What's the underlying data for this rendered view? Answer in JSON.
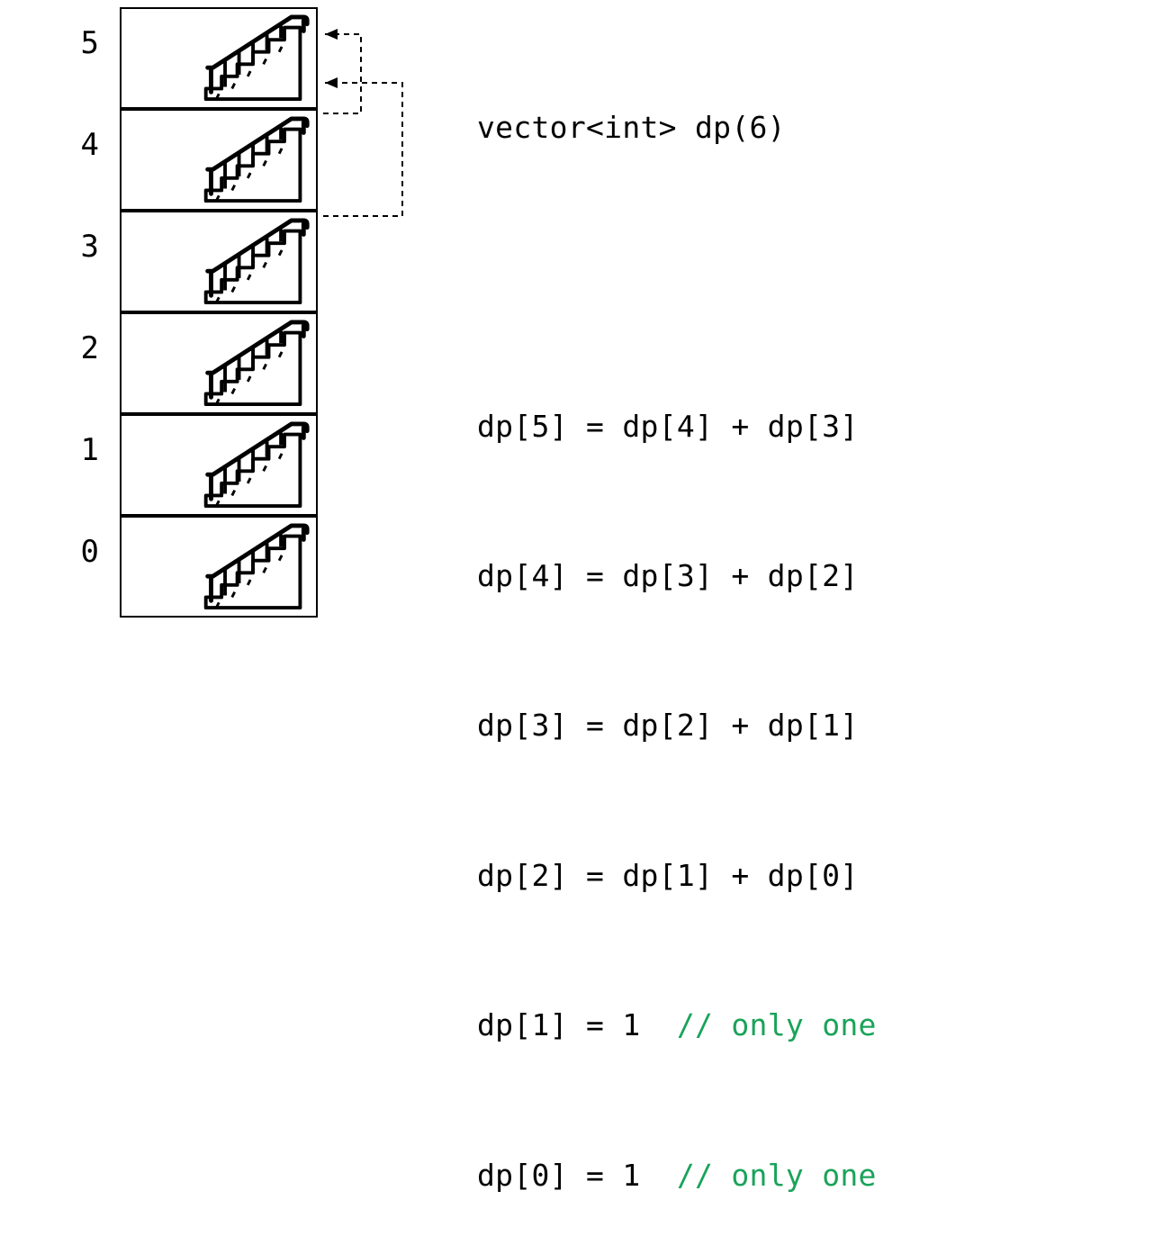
{
  "cells": [
    {
      "index": "5"
    },
    {
      "index": "4"
    },
    {
      "index": "3"
    },
    {
      "index": "2"
    },
    {
      "index": "1"
    },
    {
      "index": "0"
    }
  ],
  "code": {
    "decl": "vector<int> dp(6)",
    "lines": [
      {
        "text": "dp[5] = dp[4] + dp[3]"
      },
      {
        "text": "dp[4] = dp[3] + dp[2]"
      },
      {
        "text": "dp[3] = dp[2] + dp[1]"
      },
      {
        "text": "dp[2] = dp[1] + dp[0]"
      },
      {
        "text": "dp[1] = 1  ",
        "comment": "// only one"
      },
      {
        "text": "dp[0] = 1  ",
        "comment": "// only one"
      }
    ]
  },
  "colors": {
    "comment": "#1aa35a",
    "text": "#000000"
  }
}
